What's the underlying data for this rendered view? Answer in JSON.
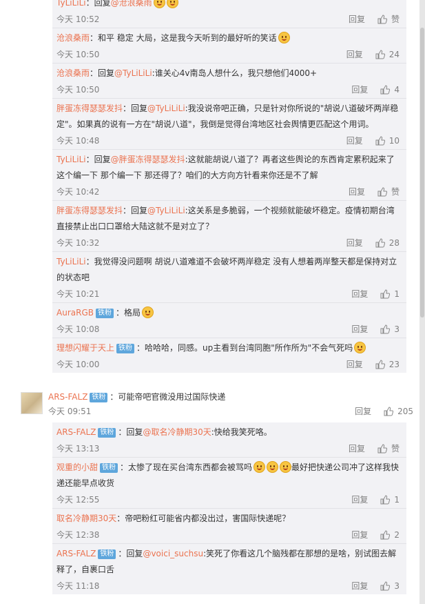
{
  "time_prefix": "今天",
  "reply_label": "回复",
  "like_zero_label": "赞",
  "top_panel": [
    {
      "name": "TyLiLiLi",
      "sep": "：回复",
      "mention": "@沧浪桑雨",
      "colon": "",
      "text": "",
      "emoji": 2,
      "time": "10:52",
      "likes": "赞"
    },
    {
      "name": "沧浪桑雨",
      "sep": "：",
      "mention": "",
      "colon": "",
      "text": "和平 稳定 大局，这是我今天听到的最好听的笑话",
      "emoji": 1,
      "time": "10:50",
      "likes": "24"
    },
    {
      "name": "沧浪桑雨",
      "sep": "：回复",
      "mention": "@TyLiLiLi",
      "colon": ":",
      "text": "谁关心4v南岛人想什么，我只想他们4000+",
      "emoji": 0,
      "time": "10:50",
      "likes": "4"
    },
    {
      "name": "胖蛋冻得瑟瑟发抖",
      "sep": "：回复",
      "mention": "@TyLiLiLi",
      "colon": ":",
      "text": "我没说帝吧正确，只是针对你所说的\"胡说八道破坏两岸稳定\"。如果真的说有一方在\"胡说八道\"，我倒是觉得台湾地区社会舆情更匹配这个用词。",
      "emoji": 0,
      "time": "10:48",
      "likes": "10"
    },
    {
      "name": "TyLiLiLi",
      "sep": "：回复",
      "mention": "@胖蛋冻得瑟瑟发抖",
      "colon": ":",
      "text": "这就能胡说八道了？再者这些舆论的东西肯定累积起来了这个编一下 那个编一下 那还得了？咱们的大方向方针看来你还是不了解",
      "emoji": 0,
      "time": "10:42",
      "likes": "赞"
    },
    {
      "name": "胖蛋冻得瑟瑟发抖",
      "sep": "：回复",
      "mention": "@TyLiLiLi",
      "colon": ":",
      "text": "这关系是多脆弱，一个视频就能破坏稳定。疫情初期台湾直接禁止出口口罩给大陆这就不是对立了？",
      "emoji": 0,
      "time": "10:32",
      "likes": "28"
    },
    {
      "name": "TyLiLiLi",
      "sep": "：",
      "mention": "",
      "colon": "",
      "text": "我觉得没问题啊 胡说八道难道不会破坏两岸稳定 没有人想着两岸整天都是保持对立的状态吧",
      "emoji": 0,
      "time": "10:21",
      "likes": "1"
    },
    {
      "name": "AuraRGB",
      "badge": "铁粉",
      "sep": "：",
      "mention": "",
      "colon": "",
      "text": "格局",
      "emoji": 1,
      "time": "10:08",
      "likes": "3"
    },
    {
      "name": "理想闪耀于天上",
      "badge": "铁粉",
      "sep": "：",
      "mention": "",
      "colon": "",
      "text": "哈哈哈，同感。up主看到台湾同胞\"所作所为\"不会气死吗",
      "emoji": 1,
      "time": "10:00",
      "likes": "23"
    }
  ],
  "top_comment": {
    "name": "ARS-FALZ",
    "badge": "铁粉",
    "text": "：可能帝吧官微没用过国际快递",
    "time": "09:51",
    "likes": "205"
  },
  "bottom_panel": [
    {
      "name": "ARS-FALZ",
      "badge": "铁粉",
      "sep": "：回复",
      "mention": "@取名冷静期30天",
      "colon": ":",
      "text": "快给我笑死咯。",
      "emoji": 0,
      "time": "13:13",
      "likes": "赞"
    },
    {
      "name": "观重的小甜",
      "badge": "铁粉",
      "sep": "：",
      "mention": "",
      "colon": "",
      "text": "太惨了现在买台湾东西都会被骂吗",
      "emoji": 3,
      "text2": "最好把快递公司冲了这样我快递还能早点收货",
      "time": "12:55",
      "likes": "1"
    },
    {
      "name": "取名冷静期30天",
      "sep": "：",
      "mention": "",
      "colon": "",
      "text": "帝吧粉红可能省内都没出过，害国际快递呢？",
      "emoji": 0,
      "time": "12:38",
      "likes": "2"
    },
    {
      "name": "ARS-FALZ",
      "badge": "铁粉",
      "sep": "：回复",
      "mention": "@voici_suchsu",
      "colon": ":",
      "text": "笑死了你看这几个脑残都在那想的是啥，别试图去解释了，自裹口舌",
      "emoji": 0,
      "time": "11:18",
      "likes": "3"
    }
  ]
}
